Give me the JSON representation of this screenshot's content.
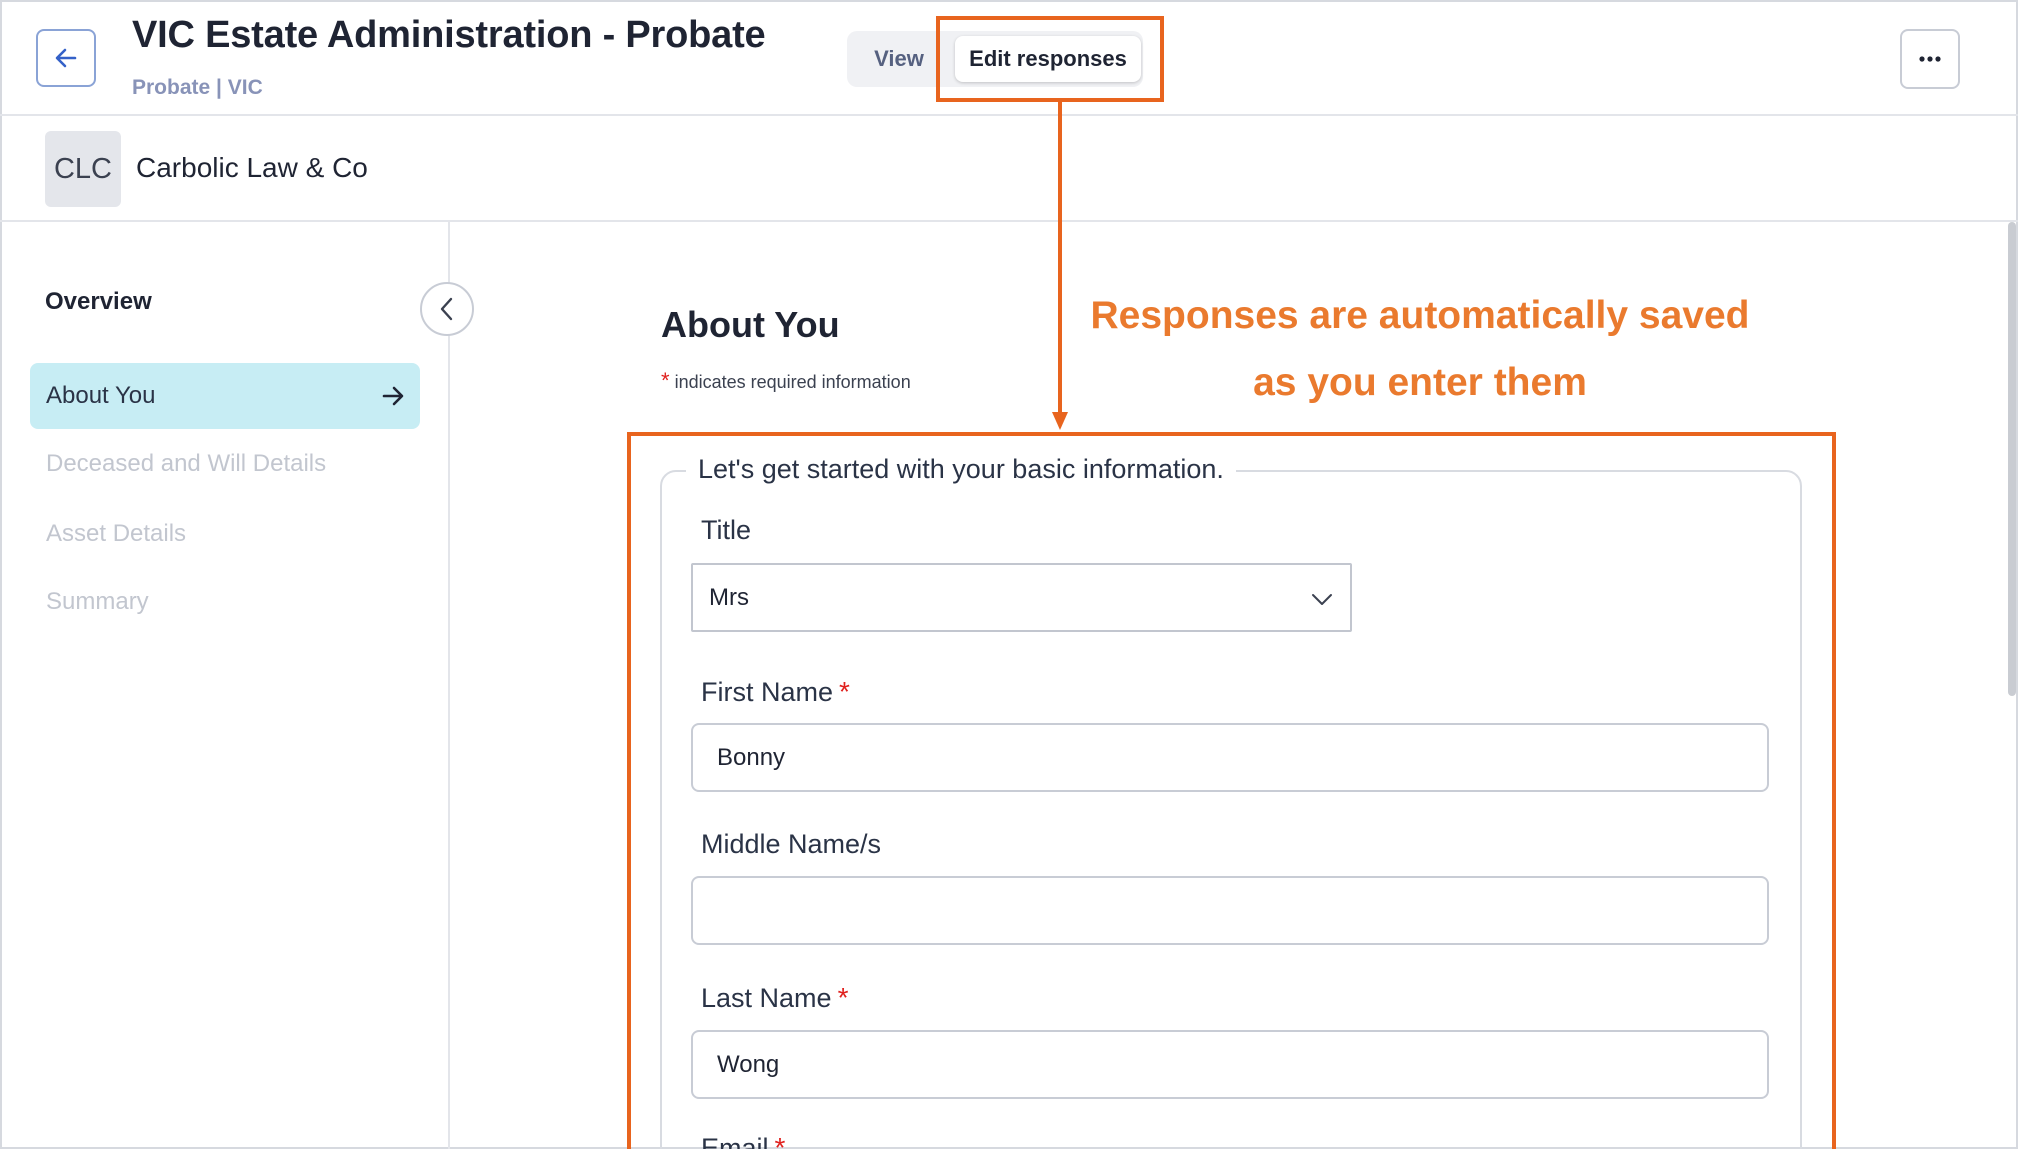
{
  "header": {
    "title": "VIC Estate Administration - Probate",
    "breadcrumb": "Probate | VIC",
    "toggle_view": "View",
    "toggle_edit": "Edit responses"
  },
  "firm": {
    "initials": "CLC",
    "name": "Carbolic Law & Co"
  },
  "sidebar": {
    "heading": "Overview",
    "items": [
      {
        "label": "About You",
        "active": true
      },
      {
        "label": "Deceased and Will Details",
        "active": false
      },
      {
        "label": "Asset Details",
        "active": false
      },
      {
        "label": "Summary",
        "active": false
      }
    ]
  },
  "main": {
    "section_title": "About You",
    "required_note": "indicates required information",
    "required_marker": "*",
    "form": {
      "legend": "Let's get started with your basic information.",
      "title_label": "Title",
      "title_value": "Mrs",
      "first_name_label": "First Name",
      "first_name_value": "Bonny",
      "middle_name_label": "Middle Name/s",
      "middle_name_value": "",
      "last_name_label": "Last Name",
      "last_name_value": "Wong",
      "email_label": "Email"
    }
  },
  "annotation": {
    "line1": "Responses are automatically saved",
    "line2": "as you enter them"
  },
  "colors": {
    "accent_orange": "#e8641e",
    "active_nav_bg": "#c7edf4",
    "required_red": "#e0211e",
    "breadcrumb": "#8893b8"
  },
  "icons": {
    "back": "arrow-left-icon",
    "more": "ellipsis-icon",
    "nav_active": "arrow-right-icon",
    "collapse": "chevron-left-icon",
    "select": "chevron-down-icon"
  }
}
